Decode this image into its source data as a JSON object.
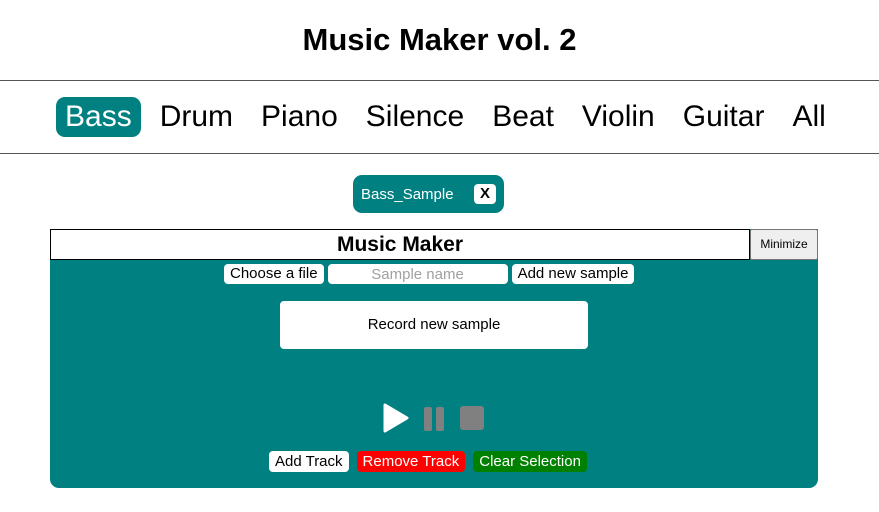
{
  "header": {
    "title": "Music Maker vol. 2"
  },
  "nav": {
    "items": [
      {
        "label": "Bass"
      },
      {
        "label": "Drum"
      },
      {
        "label": "Piano"
      },
      {
        "label": "Silence"
      },
      {
        "label": "Beat"
      },
      {
        "label": "Violin"
      },
      {
        "label": "Guitar"
      },
      {
        "label": "All"
      }
    ],
    "active": "Bass"
  },
  "sample_chip": {
    "label": "Bass_Sample",
    "close_label": "X"
  },
  "panel": {
    "title": "Music Maker",
    "minimize_label": "Minimize",
    "choose_file_label": "Choose a file",
    "sample_name_placeholder": "Sample name",
    "add_sample_label": "Add new sample",
    "record_label": "Record new sample",
    "playback": {
      "play_icon": "play-icon",
      "pause_icon": "pause-icon",
      "stop_icon": "stop-icon"
    },
    "add_track_label": "Add Track",
    "remove_track_label": "Remove Track",
    "clear_selection_label": "Clear Selection"
  },
  "colors": {
    "accent": "#008080",
    "danger": "#ff0000",
    "success": "#008000",
    "disabled": "#808080"
  }
}
